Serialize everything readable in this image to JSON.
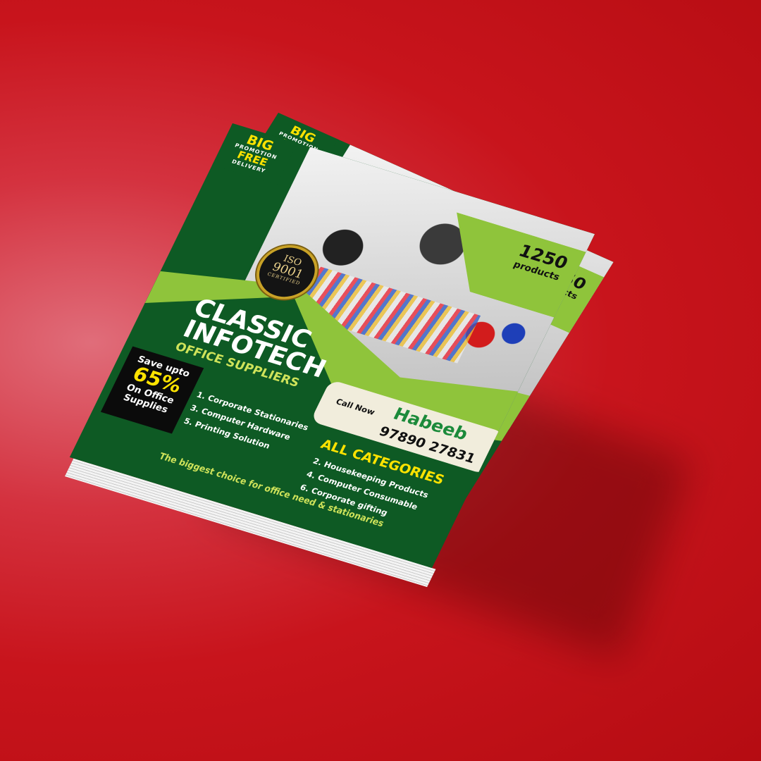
{
  "flyer": {
    "badge": {
      "big": "BIG",
      "promotion": "PROMOTION",
      "free": "FREE",
      "delivery": "DELIVERY"
    },
    "products": {
      "count": "1250",
      "label": "products"
    },
    "iso": {
      "line1": "ISO",
      "line2": "9001",
      "line3": "CERTIFIED"
    },
    "brand": {
      "line1": "CLASSIC",
      "line2": "INFOTECH",
      "subtitle": "OFFICE SUPPLIERS"
    },
    "save": {
      "line1": "Save upto",
      "percent": "65%",
      "line3": "On Office",
      "line4": "Supplies"
    },
    "call": {
      "label": "Call Now",
      "name": "Habeeb",
      "phone": "97890 27831"
    },
    "categories": {
      "title": "ALL CATEGORIES",
      "left": [
        "1. Corporate Stationaries",
        "3. Computer Hardware",
        "5. Printing Solution"
      ],
      "right": [
        "2. Housekeeping Products",
        "4. Computer Consumable",
        "6. Corporate gifting"
      ]
    },
    "tagline": "The biggest choice for office need & stationaries"
  },
  "colors": {
    "background": "#c8141c",
    "flyer_green": "#0e5a24",
    "lime": "#8fc43b",
    "accent_yellow": "#ffe300",
    "name_green": "#1b8a3a"
  }
}
